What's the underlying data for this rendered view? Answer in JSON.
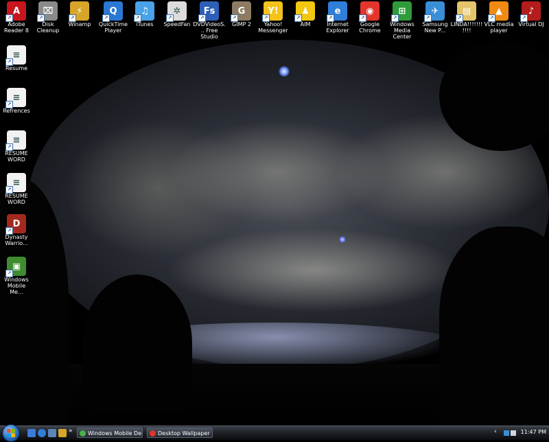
{
  "desktop": {
    "top_icons": [
      {
        "label": "Adobe Reader 8",
        "icon": "adobe-reader-icon",
        "color": "#c8161d",
        "glyph": "A"
      },
      {
        "label": "Disk Cleanup",
        "icon": "disk-cleanup-icon",
        "color": "#8a8a8a",
        "glyph": "⌧"
      },
      {
        "label": "Winamp",
        "icon": "winamp-icon",
        "color": "#d8a52b",
        "glyph": "⚡"
      },
      {
        "label": "QuickTime Player",
        "icon": "quicktime-icon",
        "color": "#2a77d4",
        "glyph": "Q"
      },
      {
        "label": "iTunes",
        "icon": "itunes-icon",
        "color": "#4aa3e8",
        "glyph": "♫"
      },
      {
        "label": "SpeedFan",
        "icon": "speedfan-icon",
        "color": "#dcdcdc",
        "glyph": "✲"
      },
      {
        "label": "DVDVideoS... Free Studio",
        "icon": "dvdvideosoft-icon",
        "color": "#2d5fb8",
        "glyph": "Fs"
      },
      {
        "label": "GIMP 2",
        "icon": "gimp-icon",
        "color": "#8c7b62",
        "glyph": "G"
      },
      {
        "label": "Yahoo! Messenger",
        "icon": "yahoo-messenger-icon",
        "color": "#f4c21b",
        "glyph": "Y!"
      },
      {
        "label": "AIM",
        "icon": "aim-icon",
        "color": "#f2c811",
        "glyph": "♟"
      },
      {
        "label": "Internet Explorer",
        "icon": "internet-explorer-icon",
        "color": "#2f7ed8",
        "glyph": "e"
      },
      {
        "label": "Google Chrome",
        "icon": "google-chrome-icon",
        "color": "#e3352c",
        "glyph": "◉"
      },
      {
        "label": "Windows Media Center",
        "icon": "windows-media-center-icon",
        "color": "#2f9b3a",
        "glyph": "⊞"
      },
      {
        "label": "Samsung New P...",
        "icon": "samsung-icon",
        "color": "#3a8ed8",
        "glyph": "✈"
      },
      {
        "label": "LINDA!!!!!!!!!!!",
        "icon": "folder-icon",
        "color": "#e3c46a",
        "glyph": "▤"
      },
      {
        "label": "VLC media player",
        "icon": "vlc-icon",
        "color": "#f08a12",
        "glyph": "▲"
      },
      {
        "label": "Virtual DJ",
        "icon": "virtual-dj-icon",
        "color": "#b31c1c",
        "glyph": "♪"
      }
    ],
    "left_icons": [
      {
        "label": "Resume",
        "icon": "document-icon",
        "color": "#f2f2f2",
        "glyph": "≡"
      },
      {
        "label": "Refrences",
        "icon": "document-icon",
        "color": "#f2f2f2",
        "glyph": "≡"
      },
      {
        "label": "RESUME WORD",
        "icon": "word-document-icon",
        "color": "#f2f2f2",
        "glyph": "≡"
      },
      {
        "label": "RESUME WORD",
        "icon": "word-document-icon",
        "color": "#f2f2f2",
        "glyph": "≡"
      },
      {
        "label": "Dynasty Warrio...",
        "icon": "dynasty-warriors-icon",
        "color": "#a3291e",
        "glyph": "D"
      },
      {
        "label": "Windows Mobile Me...",
        "icon": "windows-mobile-icon",
        "color": "#3e8c2f",
        "glyph": "▣"
      }
    ]
  },
  "taskbar": {
    "start_label": "Start",
    "tasks": [
      {
        "label": "Windows Mobile De...",
        "icon": "windows-mobile-task-icon",
        "color": "#47b347"
      },
      {
        "label": "Desktop Wallpaper ...",
        "icon": "chrome-task-icon",
        "color": "#e3352c"
      }
    ],
    "overflow": "»",
    "clock": "11:47 PM",
    "tray_chevron": "‹"
  }
}
